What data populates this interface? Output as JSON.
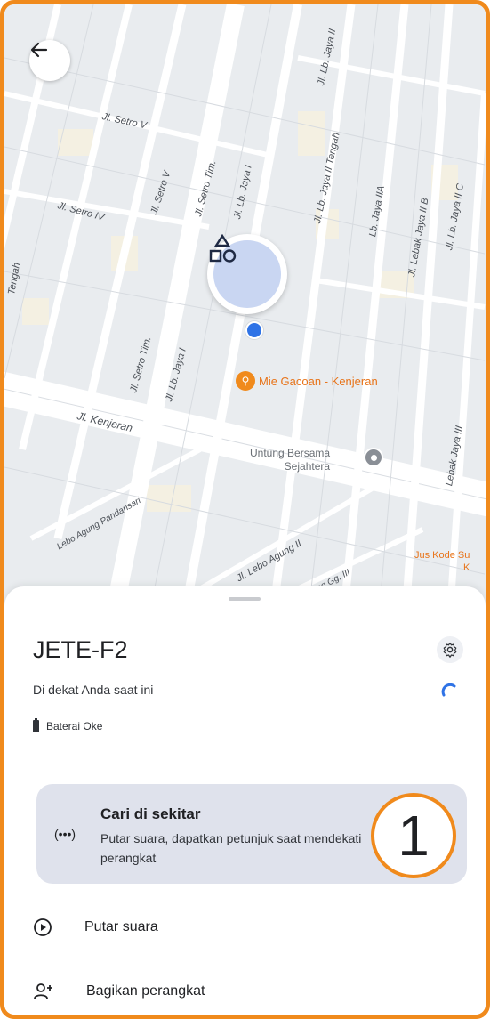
{
  "map": {
    "streets": {
      "setro_v_1": "Jl. Setro V",
      "setro_v_2": "Jl. Setro V",
      "setro_iv": "Jl. Setro IV",
      "setro_tim_1": "Jl. Setro Tim.",
      "setro_tim_2": "Jl. Setro Tim.",
      "lb_jaya_i_1": "Jl. Lb. Jaya I",
      "lb_jaya_i_2": "Jl. Lb. Jaya I",
      "lb_jaya_ii": "Jl. Lb. Jaya II",
      "lb_jaya_ii_tengah": "Jl. Lb. Jaya II Tengah",
      "lb_jaya_iia": "Lb. Jaya IIA",
      "lebak_jaya_iib": "Jl. Lebak Jaya II B",
      "lb_jaya_iic": "Jl. Lb. Jaya II C",
      "lebak_jaya_iii": "Lebak Jaya III",
      "kenjeran": "Jl. Kenjeran",
      "lebo_agung_pandansari": "Lebo Agung Pandansari",
      "lebo_agung_ii": "Jl. Lebo Agung II",
      "agung_gg_iii": "Agung Gg. III",
      "tengah": "Tengah"
    },
    "poi_food": "Mie Gacoan - Kenjeran",
    "poi_bank_line1": "Untung Bersama",
    "poi_bank_line2": "Sejahtera",
    "poi_jus_line1": "Jus Kode Su",
    "poi_jus_line2": "K"
  },
  "device": {
    "name": "JETE-F2",
    "status": "Di dekat Anda saat ini",
    "battery": "Baterai Oke"
  },
  "find_nearby": {
    "title": "Cari di sekitar",
    "description": "Putar suara, dapatkan petunjuk saat mendekati perangkat",
    "icon": "(•••)"
  },
  "annotation_number": "1",
  "actions": {
    "play_sound": "Putar suara",
    "share_device": "Bagikan perangkat"
  },
  "colors": {
    "accent_orange": "#f08a1c",
    "location_blue": "#2f73e6",
    "card_bg": "#dfe2ec"
  }
}
